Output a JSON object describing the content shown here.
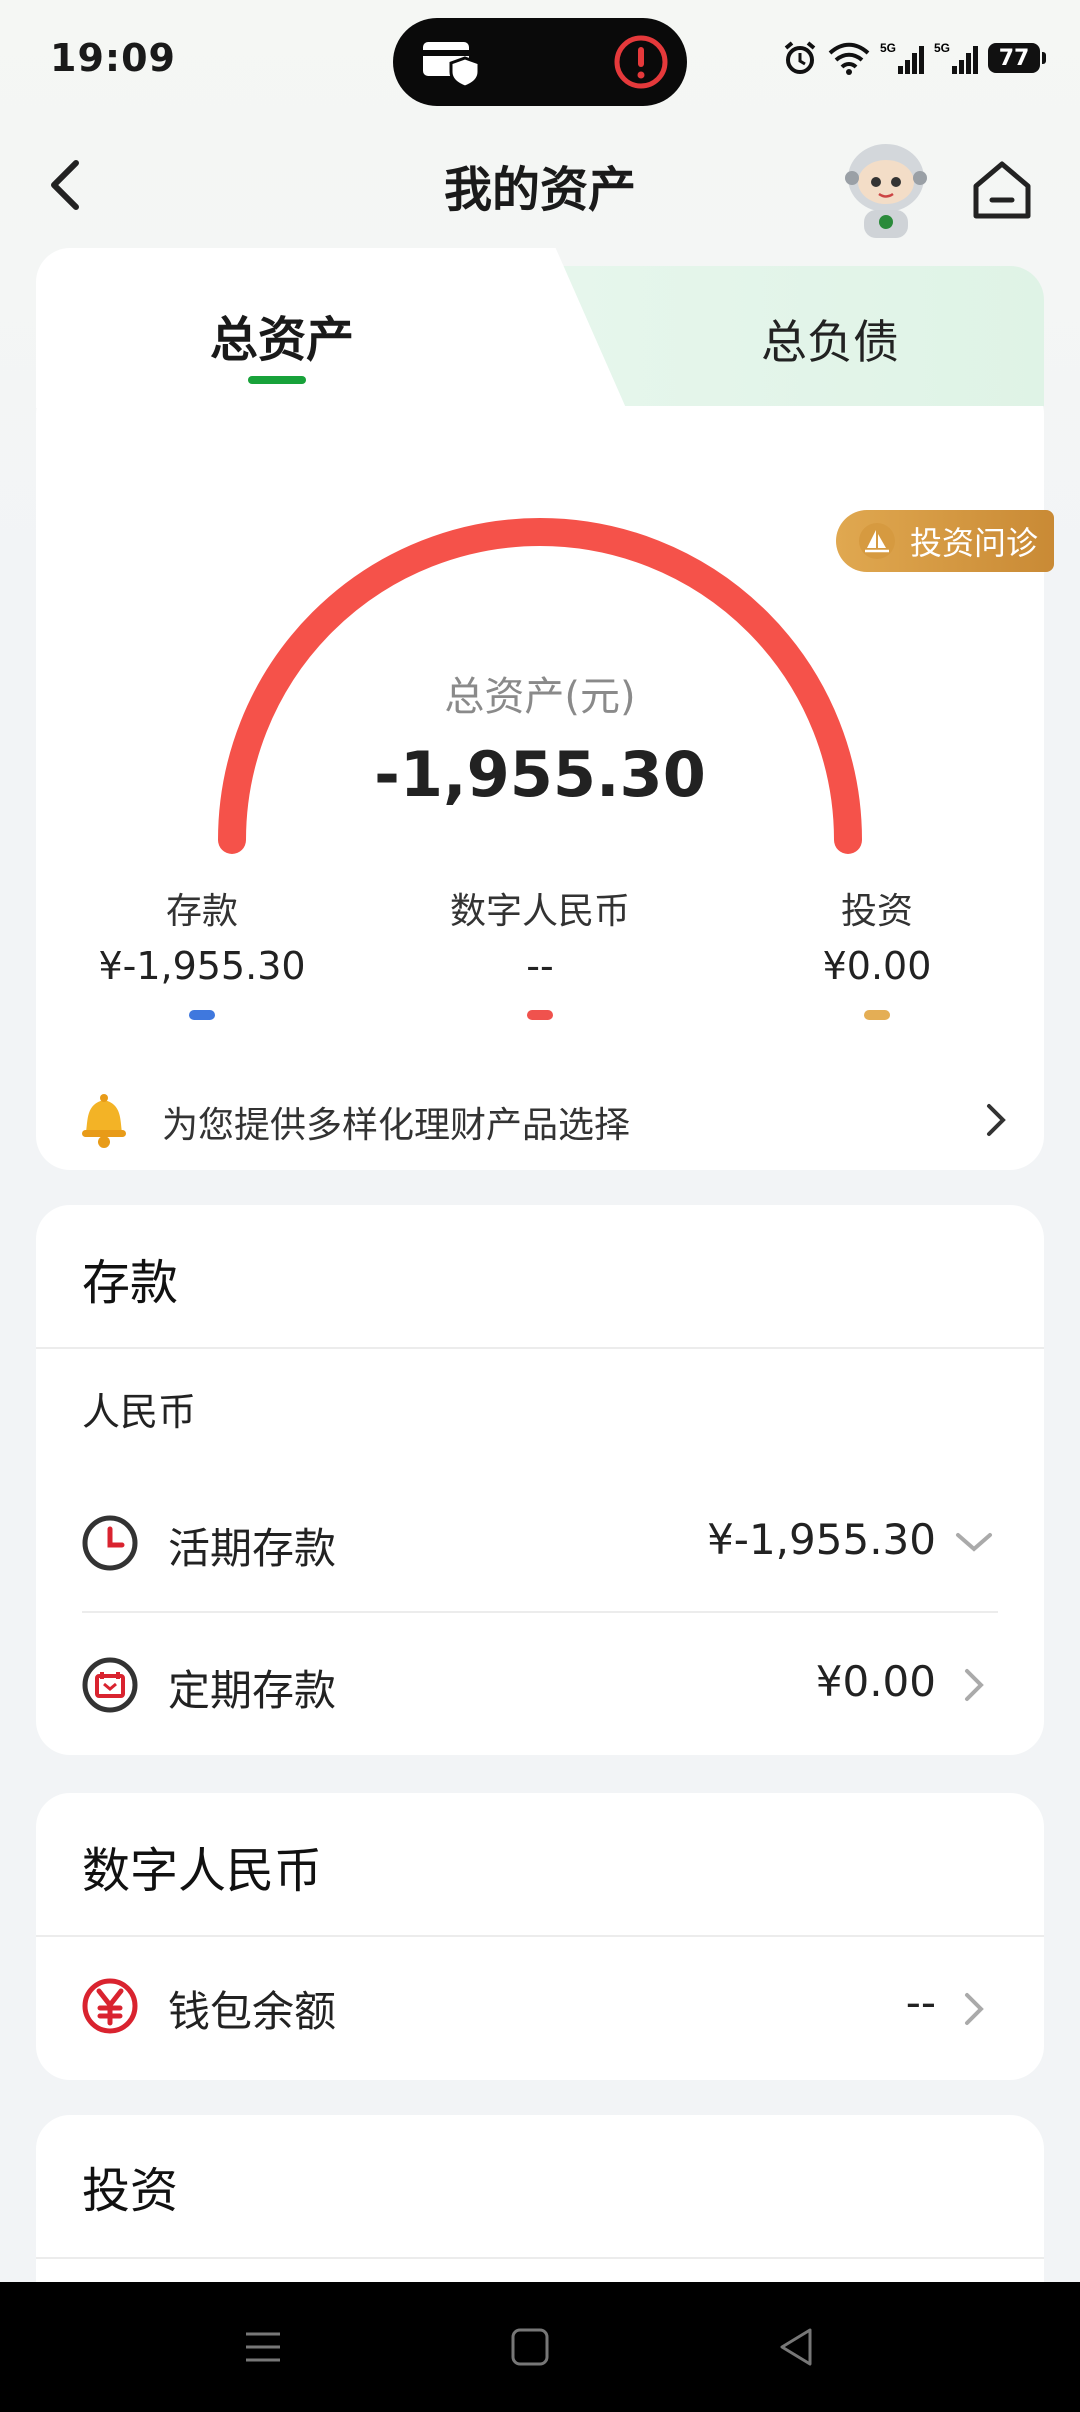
{
  "status_bar": {
    "time": "19:09",
    "battery": "77",
    "network_1": "5G",
    "network_2": "5G"
  },
  "header": {
    "title": "我的资产"
  },
  "tabs": [
    {
      "label": "总资产"
    },
    {
      "label": "总负债"
    }
  ],
  "badge": {
    "label": "投资问诊"
  },
  "gauge": {
    "label": "总资产(元)",
    "value": "-1,955.30"
  },
  "breakdown": [
    {
      "label": "存款",
      "value": "¥-1,955.30",
      "color": "#3f78de"
    },
    {
      "label": "数字人民币",
      "value": "--",
      "color": "#f0524d"
    },
    {
      "label": "投资",
      "value": "¥0.00",
      "color": "#e4ae55"
    }
  ],
  "tip": {
    "text": "为您提供多样化理财产品选择"
  },
  "deposit": {
    "title": "存款",
    "currency": "人民币",
    "rows": [
      {
        "label": "活期存款",
        "value": "¥-1,955.30"
      },
      {
        "label": "定期存款",
        "value": "¥0.00"
      }
    ]
  },
  "ecny": {
    "title": "数字人民币",
    "rows": [
      {
        "label": "钱包余额",
        "value": "--"
      }
    ]
  },
  "invest": {
    "title": "投资"
  },
  "colors": {
    "accent_green": "#18a23a",
    "gauge_red": "#f5524a",
    "icon_red": "#d9232f"
  }
}
